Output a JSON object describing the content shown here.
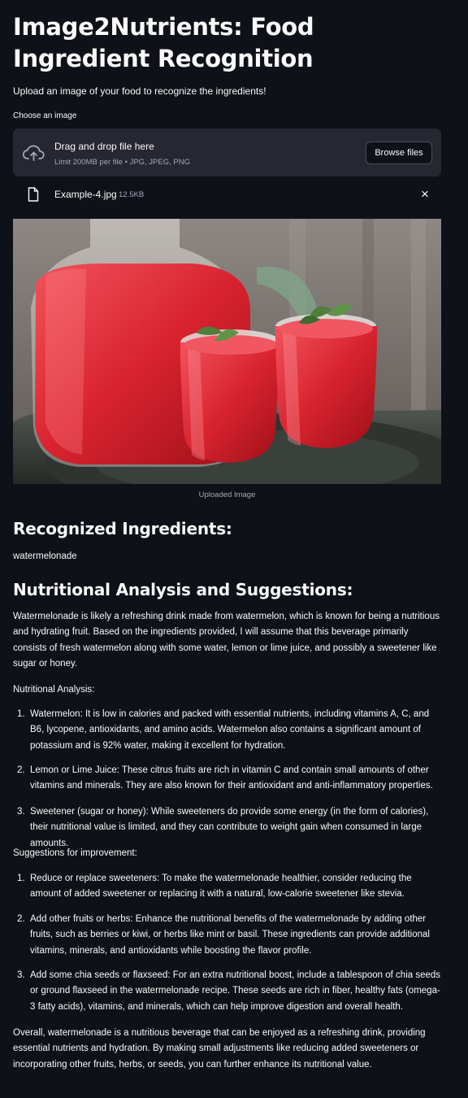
{
  "header": {
    "title": "Image2Nutrients: Food Ingredient Recognition",
    "subtitle": "Upload an image of your food to recognize the ingredients!"
  },
  "uploader": {
    "label": "Choose an image",
    "drop_text": "Drag and drop file here",
    "limit_text": "Limit 200MB per file • JPG, JPEG, PNG",
    "browse_label": "Browse files",
    "icon": "cloud-upload-icon"
  },
  "file": {
    "name": "Example-4.jpg",
    "size": "12.5KB",
    "icon": "file-icon",
    "close": "×"
  },
  "image": {
    "caption": "Uploaded Image"
  },
  "ingredients": {
    "heading": "Recognized Ingredients:",
    "value": "watermelonade"
  },
  "analysis": {
    "heading": "Nutritional Analysis and Suggestions:",
    "intro": "Watermelonade is likely a refreshing drink made from watermelon, which is known for being a nutritious and hydrating fruit. Based on the ingredients provided, I will assume that this beverage primarily consists of fresh watermelon along with some water, lemon or lime juice, and possibly a sweetener like sugar or honey.",
    "nutrition_label": "Nutritional Analysis:",
    "nutrition_items": [
      {
        "num": "1.",
        "text": "Watermelon: It is low in calories and packed with essential nutrients, including vitamins A, C, and B6, lycopene, antioxidants, and amino acids. Watermelon also contains a significant amount of potassium and is 92% water, making it excellent for hydration."
      },
      {
        "num": "2.",
        "text": "Lemon or Lime Juice: These citrus fruits are rich in vitamin C and contain small amounts of other vitamins and minerals. They are also known for their antioxidant and anti-inflammatory properties."
      },
      {
        "num": "3.",
        "text": "Sweetener (sugar or honey): While sweeteners do provide some energy (in the form of calories), their nutritional value is limited, and they can contribute to weight gain when consumed in large amounts."
      }
    ],
    "suggestions_label": "Suggestions for improvement:",
    "suggestion_items": [
      {
        "num": "1.",
        "text": "Reduce or replace sweeteners: To make the watermelonade healthier, consider reducing the amount of added sweetener or replacing it with a natural, low-calorie sweetener like stevia."
      },
      {
        "num": "2.",
        "text": "Add other fruits or herbs: Enhance the nutritional benefits of the watermelonade by adding other fruits, such as berries or kiwi, or herbs like mint or basil. These ingredients can provide additional vitamins, minerals, and antioxidants while boosting the flavor profile."
      },
      {
        "num": "3.",
        "text": "Add some chia seeds or flaxseed: For an extra nutritional boost, include a tablespoon of chia seeds or ground flaxseed in the watermelonade recipe. These seeds are rich in fiber, healthy fats (omega-3 fatty acids), vitamins, and minerals, which can help improve digestion and overall health."
      }
    ],
    "overall": "Overall, watermelonade is a nutritious beverage that can be enjoyed as a refreshing drink, providing essential nutrients and hydration. By making small adjustments like reducing added sweeteners or incorporating other fruits, herbs, or seeds, you can further enhance its nutritional value."
  },
  "colors": {
    "background": "#0e1117",
    "panel": "#262730",
    "text": "#fafafa",
    "muted": "#a3a8b8"
  }
}
